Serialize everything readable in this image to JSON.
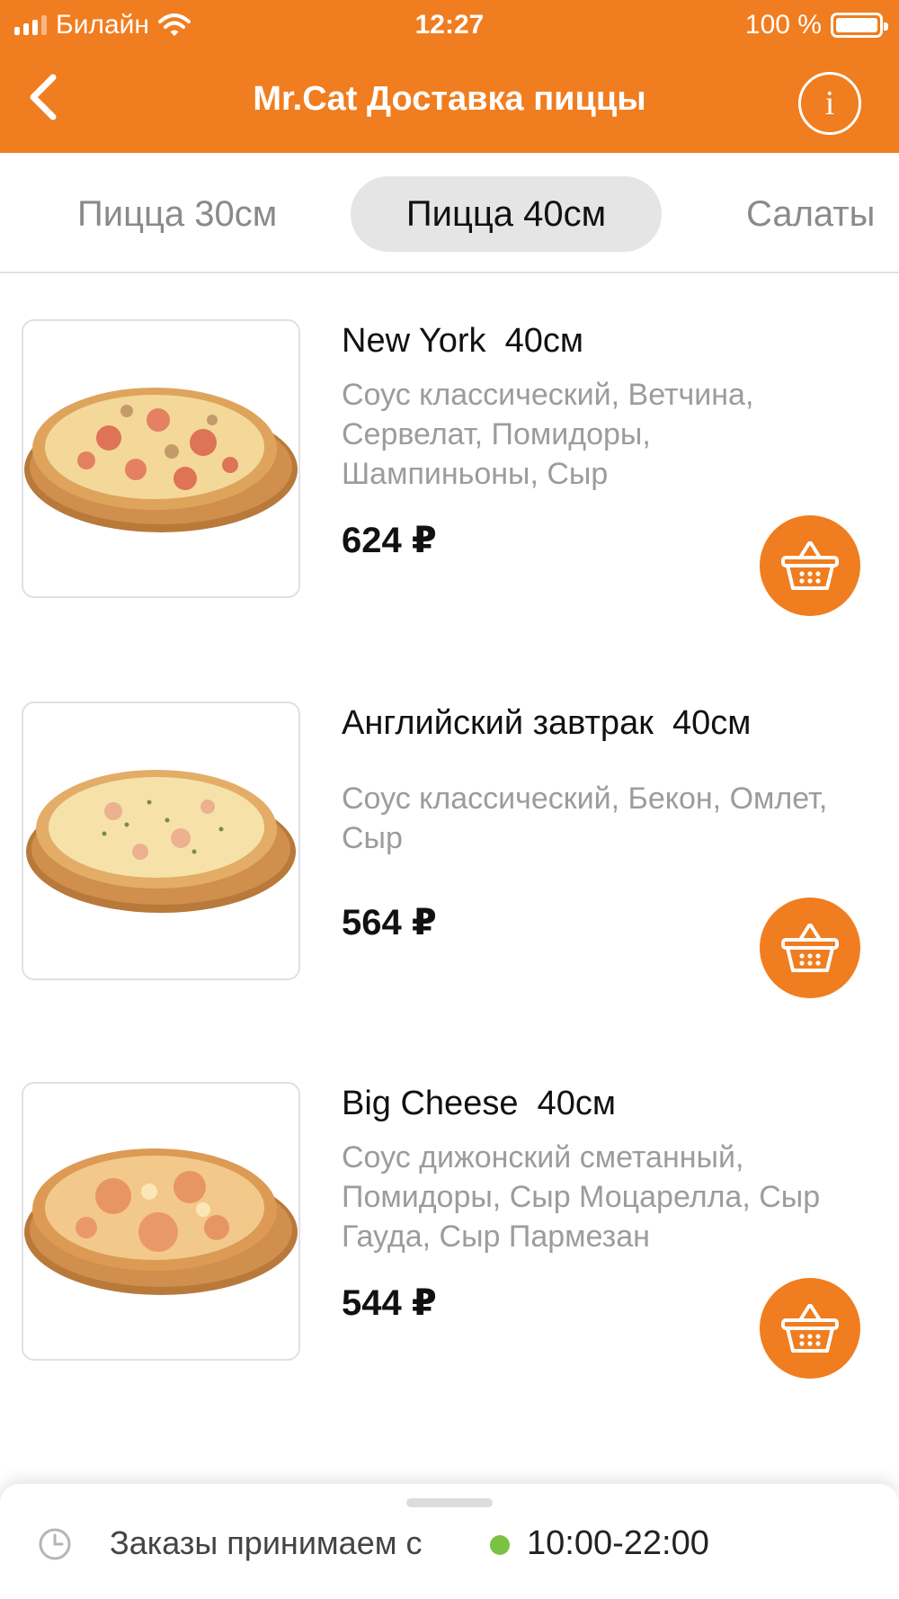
{
  "status_bar": {
    "carrier": "Билайн",
    "time": "12:27",
    "battery": "100 %"
  },
  "nav": {
    "title": "Mr.Cat Доставка пиццы",
    "back_icon": "chevron-left-icon",
    "info_label": "i"
  },
  "tabs": [
    {
      "label": "Пицца 30см",
      "active": false
    },
    {
      "label": "Пицца 40см",
      "active": true
    },
    {
      "label": "Салаты",
      "active": false
    }
  ],
  "products": [
    {
      "name": "New York  40см",
      "description": "Соус классический, Ветчина, Сервелат, Помидоры, Шампиньоны, Сыр",
      "price": "624 ₽"
    },
    {
      "name": "Английский завтрак  40см",
      "description": "Соус классический, Бекон, Омлет, Сыр",
      "price": "564 ₽"
    },
    {
      "name": "Big Cheese  40см",
      "description": "Соус дижонский сметанный, Помидоры, Сыр Моцарелла, Сыр Гауда, Сыр Пармезан",
      "price": "544 ₽"
    }
  ],
  "footer": {
    "hours_label": "Заказы принимаем с",
    "hours_value": "10:00-22:00",
    "status_color": "#7cc242"
  },
  "colors": {
    "accent": "#f07d1f",
    "active_tab_bg": "#e5e5e5"
  }
}
